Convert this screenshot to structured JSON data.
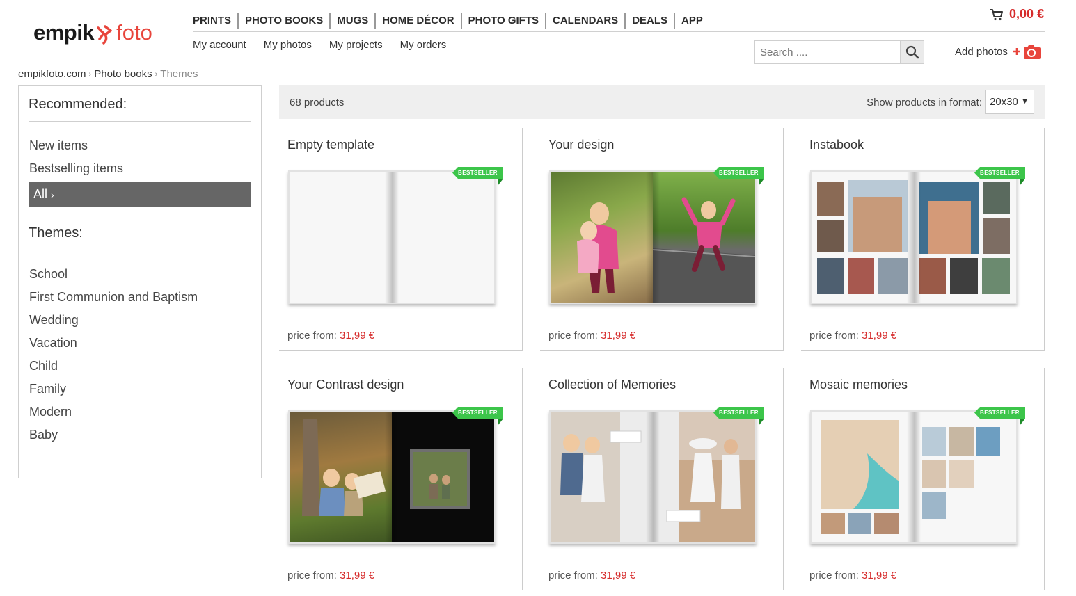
{
  "logo": {
    "part1": "empik",
    "part2": "foto"
  },
  "main_nav": [
    "PRINTS",
    "PHOTO BOOKS",
    "MUGS",
    "HOME DÉCOR",
    "PHOTO GIFTS",
    "CALENDARS",
    "DEALS",
    "APP"
  ],
  "cart": {
    "amount": "0,00 €",
    "icon": "cart-icon"
  },
  "sub_nav": [
    "My account",
    "My photos",
    "My projects",
    "My orders"
  ],
  "search": {
    "placeholder": "Search ....",
    "icon": "search-icon"
  },
  "add_photos": {
    "label": "Add photos",
    "icon": "add-camera-icon"
  },
  "breadcrumb": [
    "empikfoto.com",
    "Photo books",
    "Themes"
  ],
  "sidebar": {
    "recommended_heading": "Recommended:",
    "recommended": [
      "New items",
      "Bestselling items"
    ],
    "active_item": "All",
    "themes_heading": "Themes:",
    "themes": [
      "School",
      "First Communion and Baptism",
      "Wedding",
      "Vacation",
      "Child",
      "Family",
      "Modern",
      "Baby"
    ]
  },
  "listing": {
    "count": "68 products",
    "format_label": "Show products in format:",
    "format_value": "20x30"
  },
  "products": [
    {
      "title": "Empty template",
      "badge": "BESTSELLER",
      "price_label": "price from:",
      "price": "31,99 €"
    },
    {
      "title": "Your design",
      "badge": "BESTSELLER",
      "price_label": "price from:",
      "price": "31,99 €"
    },
    {
      "title": "Instabook",
      "badge": "BESTSELLER",
      "price_label": "price from:",
      "price": "31,99 €"
    },
    {
      "title": "Your Contrast design",
      "badge": "BESTSELLER",
      "price_label": "price from:",
      "price": "31,99 €"
    },
    {
      "title": "Collection of Memories",
      "badge": "BESTSELLER",
      "price_label": "price from:",
      "price": "31,99 €"
    },
    {
      "title": "Mosaic memories",
      "badge": "BESTSELLER",
      "price_label": "price from:",
      "price": "31,99 €"
    }
  ],
  "colors": {
    "accent_red": "#d62b2b",
    "badge_green": "#3cc54a",
    "active_bg": "#666666"
  }
}
